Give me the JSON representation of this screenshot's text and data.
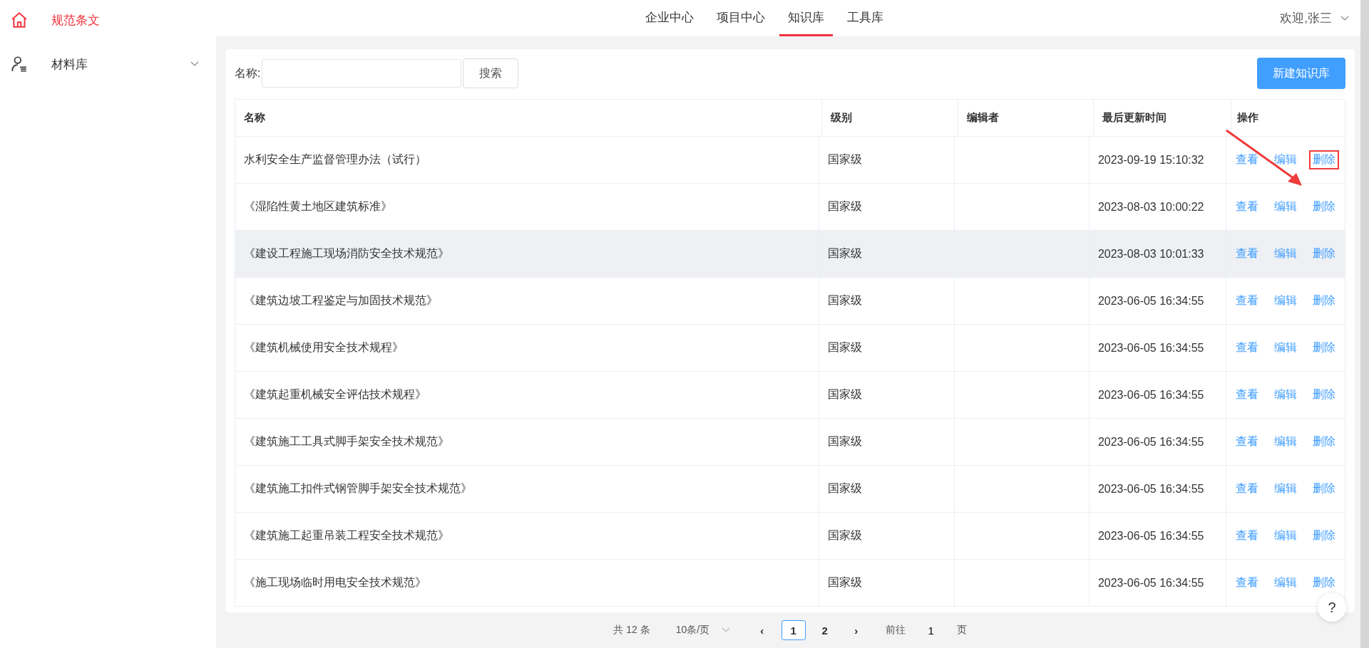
{
  "sidebar": {
    "items": [
      {
        "label": "规范条文",
        "selected": true
      },
      {
        "label": "材料库",
        "selected": false,
        "expanded": false
      }
    ]
  },
  "nav": {
    "tabs": [
      {
        "label": "企业中心",
        "selected": false
      },
      {
        "label": "项目中心",
        "selected": false
      },
      {
        "label": "知识库",
        "selected": true
      },
      {
        "label": "工具库",
        "selected": false
      }
    ],
    "user": "欢迎,张三"
  },
  "search": {
    "label": "名称:",
    "button": "搜索"
  },
  "create_button": "新建知识库",
  "table": {
    "columns": [
      "名称",
      "级别",
      "编辑者",
      "最后更新时间",
      "操作"
    ],
    "rows": [
      {
        "name": "水利安全生产监督管理办法（试行）",
        "level": "国家级",
        "time": "2023-09-19 15:10:32",
        "actions": [
          "查看",
          "编辑",
          "删除"
        ],
        "highlighted": false,
        "marked": true
      },
      {
        "name": "《湿陷性黄土地区建筑标准》",
        "level": "国家级",
        "time": "2023-08-03 10:00:22",
        "actions": [
          "查看",
          "编辑",
          "删除"
        ],
        "highlighted": false,
        "marked": false
      },
      {
        "name": "《建设工程施工现场消防安全技术规范》",
        "level": "国家级",
        "time": "2023-08-03 10:01:33",
        "actions": [
          "查看",
          "编辑",
          "删除"
        ],
        "highlighted": true,
        "marked": false
      },
      {
        "name": "《建筑边坡工程鉴定与加固技术规范》",
        "level": "国家级",
        "time": "2023-06-05 16:34:55",
        "actions": [
          "查看",
          "编辑",
          "删除"
        ],
        "highlighted": false,
        "marked": false
      },
      {
        "name": "《建筑机械使用安全技术规程》",
        "level": "国家级",
        "time": "2023-06-05 16:34:55",
        "actions": [
          "查看",
          "编辑",
          "删除"
        ],
        "highlighted": false,
        "marked": false
      },
      {
        "name": "《建筑起重机械安全评估技术规程》",
        "level": "国家级",
        "time": "2023-06-05 16:34:55",
        "actions": [
          "查看",
          "编辑",
          "删除"
        ],
        "highlighted": false,
        "marked": false
      },
      {
        "name": "《建筑施工工具式脚手架安全技术规范》",
        "level": "国家级",
        "time": "2023-06-05 16:34:55",
        "actions": [
          "查看",
          "编辑",
          "删除"
        ],
        "highlighted": false,
        "marked": false
      },
      {
        "name": "《建筑施工扣件式钢管脚手架安全技术规范》",
        "level": "国家级",
        "time": "2023-06-05 16:34:55",
        "actions": [
          "查看",
          "编辑",
          "删除"
        ],
        "highlighted": false,
        "marked": false
      },
      {
        "name": "《建筑施工起重吊装工程安全技术规范》",
        "level": "国家级",
        "time": "2023-06-05 16:34:55",
        "actions": [
          "查看",
          "编辑",
          "删除"
        ],
        "highlighted": false,
        "marked": false
      },
      {
        "name": "《施工现场临时用电安全技术规范》",
        "level": "国家级",
        "time": "2023-06-05 16:34:55",
        "actions": [
          "查看",
          "编辑",
          "删除"
        ],
        "highlighted": false,
        "marked": false
      }
    ]
  },
  "pagination": {
    "total": "共 12 条",
    "page_size": "10条/页",
    "prev": "‹",
    "pages": [
      {
        "label": "1",
        "selected": true
      },
      {
        "label": "2",
        "selected": false
      }
    ],
    "next": "›",
    "goto_label": "前往",
    "goto_value": "1",
    "goto_suffix": "页"
  },
  "help": "?"
}
